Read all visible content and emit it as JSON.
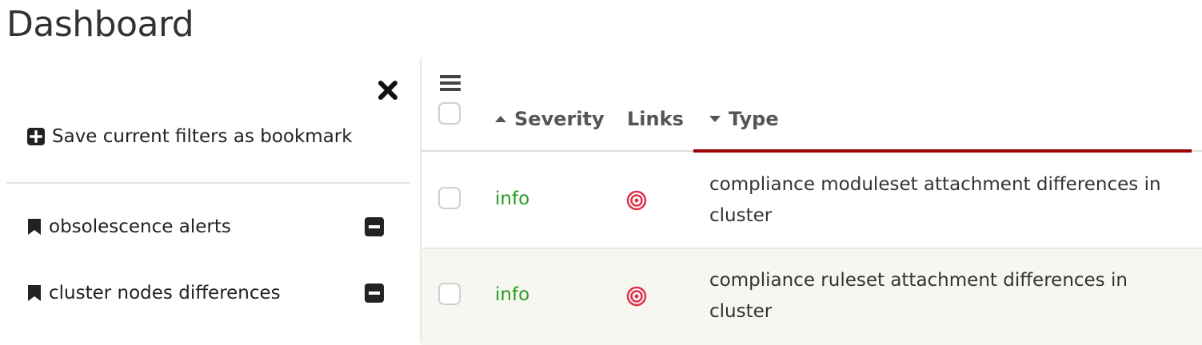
{
  "page": {
    "title": "Dashboard"
  },
  "bookmarks": {
    "save_label": "Save current filters as bookmark",
    "items": [
      {
        "label": "obsolescence alerts"
      },
      {
        "label": "cluster nodes differences"
      }
    ]
  },
  "table": {
    "columns": {
      "severity": "Severity",
      "links": "Links",
      "type": "Type"
    },
    "rows": [
      {
        "severity": "info",
        "type": "compliance moduleset attachment differences in cluster"
      },
      {
        "severity": "info",
        "type": "compliance ruleset attachment differences in cluster"
      }
    ]
  },
  "colors": {
    "severity_info": "#2a9d1f",
    "sort_underline": "#990000",
    "link_icon": "#e0314b"
  },
  "icons": {
    "close": "close-icon",
    "save": "plus-square-icon",
    "bookmark": "bookmark-icon",
    "remove": "minus-square-icon",
    "menu": "hamburger-menu-icon",
    "sort_asc": "caret-up-icon",
    "sort_desc": "caret-down-icon",
    "link": "target-icon"
  }
}
